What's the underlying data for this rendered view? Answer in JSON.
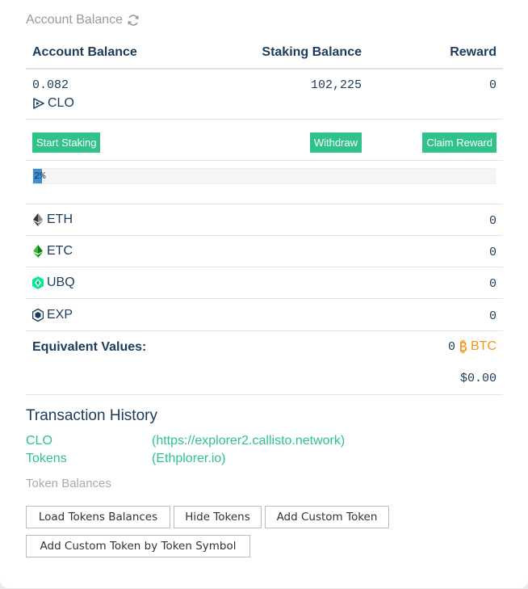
{
  "header": {
    "title": "Account Balance"
  },
  "table": {
    "col_account": "Account Balance",
    "col_staking": "Staking Balance",
    "col_reward": "Reward"
  },
  "balances": {
    "account": "0.082",
    "staking": "102,225",
    "reward": "0",
    "symbol": "CLO"
  },
  "buttons": {
    "start_staking": "Start Staking",
    "withdraw": "Withdraw",
    "claim_reward": "Claim Reward"
  },
  "progress": {
    "label": "2%",
    "value_percent": 2
  },
  "coins": [
    {
      "symbol": "ETH",
      "value": "0",
      "icon": "ethereum-icon"
    },
    {
      "symbol": "ETC",
      "value": "0",
      "icon": "ethereum-classic-icon"
    },
    {
      "symbol": "UBQ",
      "value": "0",
      "icon": "ubiq-icon"
    },
    {
      "symbol": "EXP",
      "value": "0",
      "icon": "expanse-icon"
    }
  ],
  "equivalent": {
    "label": "Equivalent Values:",
    "btc_value": "0",
    "btc_label": "BTC",
    "usd_value": "$0.00"
  },
  "history": {
    "title": "Transaction History",
    "links": [
      {
        "name": "CLO",
        "url_text": "(https://explorer2.callisto.network)"
      },
      {
        "name": "Tokens",
        "url_text": "(Ethplorer.io)"
      }
    ]
  },
  "token_balances": {
    "title": "Token Balances",
    "load": "Load Tokens Balances",
    "hide": "Hide Tokens",
    "add_custom": "Add Custom Token",
    "add_by_symbol": "Add Custom Token by Token Symbol"
  },
  "colors": {
    "accent_green": "#2fc38a",
    "text_navy": "#1b3b5a",
    "bitcoin_orange": "#f7931a",
    "progress_blue": "#3f8ed0"
  }
}
